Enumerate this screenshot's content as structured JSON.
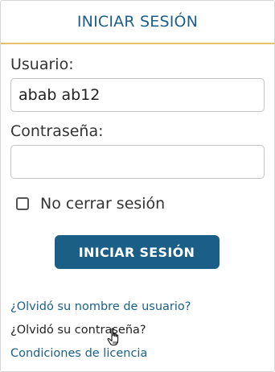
{
  "login_panel": {
    "title": "INICIAR SESIÓN",
    "username_label": "Usuario:",
    "username_value": "abab ab12",
    "password_label": "Contraseña:",
    "password_value": "",
    "remember_label": "No cerrar sesión",
    "remember_checked": false,
    "submit_label": "INICIAR SESIÓN"
  },
  "links": {
    "forgot_username": "¿Olvidó su nombre de usuario?",
    "forgot_password": "¿Olvidó su contraseña?",
    "license_terms": "Condiciones de licencia"
  },
  "colors": {
    "accent": "#1b5f87",
    "header_rule": "#e2c26a"
  },
  "cursor": {
    "icon": "hand-pointer-icon"
  }
}
